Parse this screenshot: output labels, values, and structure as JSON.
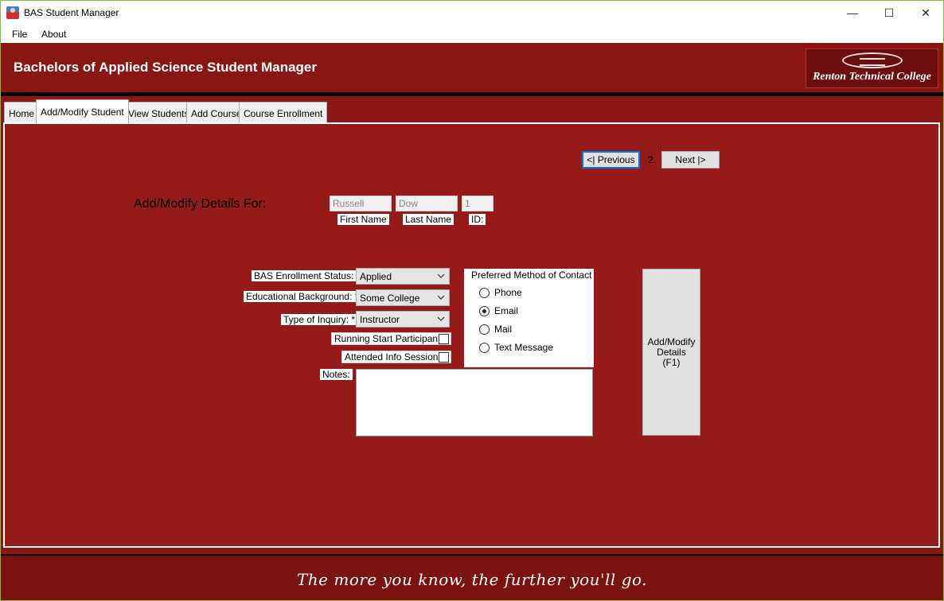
{
  "window": {
    "title": "BAS Student Manager",
    "minimize_glyph": "—",
    "maximize_glyph": "☐",
    "close_glyph": "✕"
  },
  "menu": {
    "items": [
      "File",
      "About"
    ]
  },
  "header": {
    "title": "Bachelors of Applied Science Student Manager",
    "logo_text": "Renton Technical College"
  },
  "tabs": [
    {
      "label": "Home"
    },
    {
      "label": "Add/Modify Student",
      "active": true
    },
    {
      "label": "View Students"
    },
    {
      "label": "Add Course"
    },
    {
      "label": "Course Enrollment"
    }
  ],
  "pager": {
    "previous_label": "<| Previous",
    "page_number": "2",
    "next_label": "Next |>"
  },
  "details_for": {
    "heading": "Add/Modify Details For:",
    "first_name_value": "Russell",
    "first_name_label": "First Name",
    "last_name_value": "Dow",
    "last_name_label": "Last Name",
    "id_value": "1",
    "id_label": "ID:"
  },
  "form": {
    "enrollment_status_label": "BAS Enrollment Status: *",
    "enrollment_status_value": "Applied",
    "educational_background_label": "Educational Background: *",
    "educational_background_value": "Some College",
    "inquiry_type_label": "Type of Inquiry: *",
    "inquiry_type_value": "Instructor",
    "running_start_label": "Running Start Participant?",
    "running_start_checked": false,
    "info_session_label": "Attended Info Session?",
    "info_session_checked": false,
    "notes_label": "Notes:",
    "notes_value": ""
  },
  "contact": {
    "group_label": "Preferred Method of Contact",
    "options": [
      {
        "label": "Phone",
        "checked": false
      },
      {
        "label": "Email",
        "checked": true
      },
      {
        "label": "Mail",
        "checked": false
      },
      {
        "label": "Text Message",
        "checked": false
      }
    ]
  },
  "submit": {
    "line1": "Add/Modify",
    "line2": "Details",
    "line3": "(F1)"
  },
  "footer": {
    "tagline": "The more you know, the further you'll go."
  },
  "colors": {
    "panel_bg": "#951a1a",
    "header_bg": "#8a1515",
    "footer_bg": "#7a1212",
    "focus_border": "#0078d7"
  }
}
